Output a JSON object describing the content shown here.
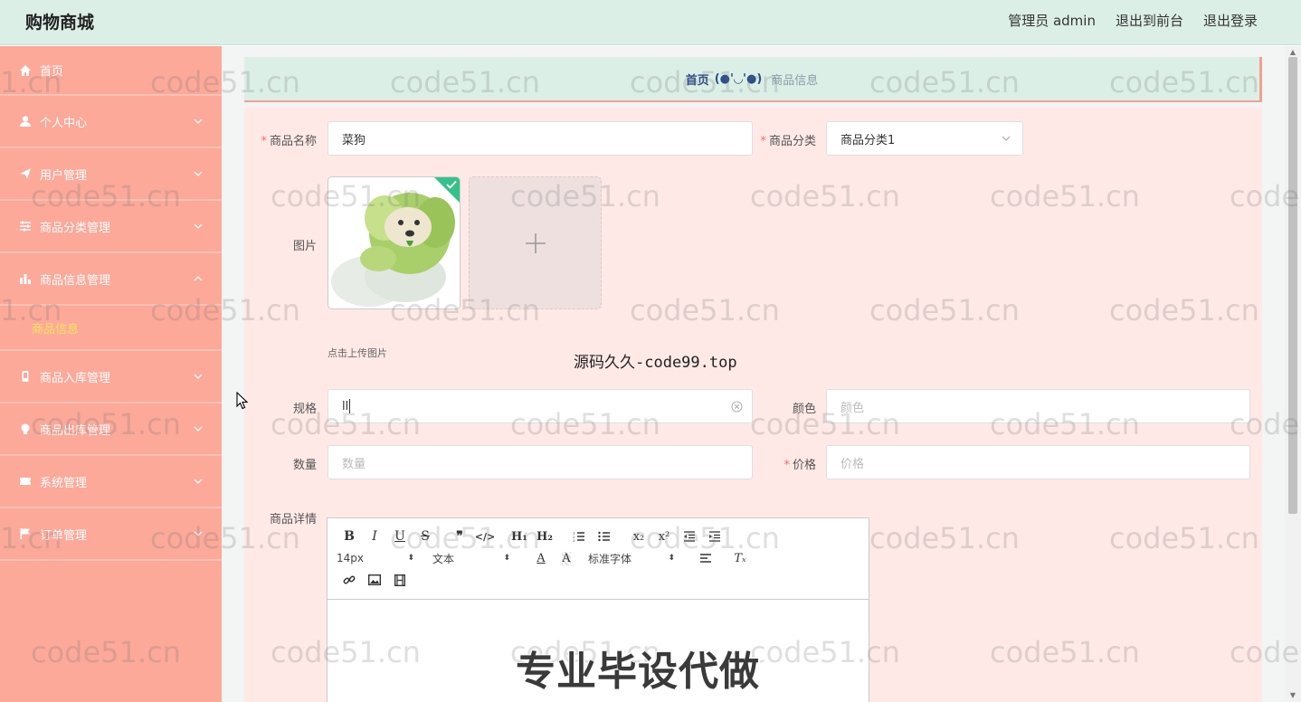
{
  "header": {
    "brand": "购物商城",
    "admin_label": "管理员 admin",
    "to_front_label": "退出到前台",
    "logout_label": "退出登录",
    "bg_color": "#dcefe7"
  },
  "sidebar": {
    "bg_color": "#fca99a",
    "items": [
      {
        "label": "首页",
        "icon": "home-icon"
      },
      {
        "label": "个人中心",
        "icon": "user-icon"
      },
      {
        "label": "用户管理",
        "icon": "send-icon"
      },
      {
        "label": "商品分类管理",
        "icon": "sliders-icon"
      },
      {
        "label": "商品信息管理",
        "icon": "bar-chart-icon",
        "expanded": true,
        "children": [
          "商品信息"
        ]
      },
      {
        "label": "商品入库管理",
        "icon": "phone-icon"
      },
      {
        "label": "商品出库管理",
        "icon": "bulb-icon"
      },
      {
        "label": "系统管理",
        "icon": "ticket-icon"
      },
      {
        "label": "订单管理",
        "icon": "flag-icon"
      }
    ]
  },
  "breadcrumb": {
    "home": "首页",
    "separator": "(●'◡'●)",
    "current": "商品信息"
  },
  "form": {
    "name": {
      "label": "商品名称",
      "value": "菜狗",
      "required": true
    },
    "category": {
      "label": "商品分类",
      "value": "商品分类1",
      "required": true
    },
    "image": {
      "label": "图片",
      "hint": "点击上传图片"
    },
    "spec": {
      "label": "规格",
      "value": "ll"
    },
    "color": {
      "label": "颜色",
      "placeholder": "颜色"
    },
    "quantity": {
      "label": "数量",
      "placeholder": "数量"
    },
    "price": {
      "label": "价格",
      "placeholder": "价格",
      "required": true
    },
    "detail": {
      "label": "商品详情"
    }
  },
  "editor": {
    "font_size": "14px",
    "block_type": "文本",
    "font_family": "标准字体"
  },
  "overlay": {
    "watermark": "code51.cn",
    "center_note": "源码久久-code99.top",
    "banner": "专业毕设代做"
  }
}
